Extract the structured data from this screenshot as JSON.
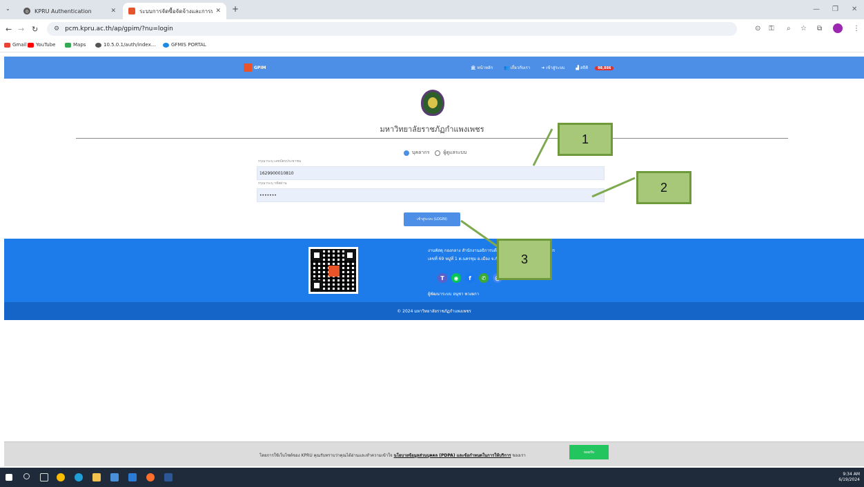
{
  "browser": {
    "tabs": [
      {
        "title": "KPRU Authentication",
        "active": false
      },
      {
        "title": "ระบบการจัดซื้อจัดจ้างและการบริหาร",
        "active": true
      }
    ],
    "url": "pcm.kpru.ac.th/ap/gpim/?nu=login",
    "bookmarks": [
      "Gmail",
      "YouTube",
      "Maps",
      "10.5.0.1/auth/index...",
      "GFMIS PORTAL"
    ]
  },
  "site": {
    "brand": "GPIM",
    "nav": {
      "home": "หน้าหลัก",
      "about": "เกี่ยวกับเรา",
      "login": "เข้าสู่ระบบ",
      "stats": "สถิติ",
      "count": "98,886"
    },
    "university_title": "มหาวิทยาลัยราชภัฏกำแพงเพชร",
    "login_form": {
      "radio_staff": "บุคลากร",
      "radio_admin": "ผู้ดูแลระบบ",
      "id_label": "กรุณาระบุ เลขบัตรประชาชน",
      "id_value": "1629900010810",
      "password_label": "กรุณาระบุ รหัสผ่าน",
      "password_value": "•••••••",
      "submit_label": "เข้าสู่ระบบ (LOGIN)"
    },
    "footer": {
      "address_line1": "งานพัสดุ กองกลาง สำนักงานอธิการบดี มหาวิทยาลัยราชภัฏกำแพงเพชร",
      "address_line2": "เลขที่ 69 หมู่ที่ 1 ต.นครชุม อ.เมือง จ.กำแพงเพชร 62000",
      "developer": "ผู้พัฒนาระบบ อนุชา พวงผกา",
      "copyright": "© 2024 มหาวิทยาลัยราชภัฏกำแพงเพชร"
    }
  },
  "annotations": [
    "1",
    "2",
    "3"
  ],
  "cookie": {
    "text_prefix": "โดยการใช้เว็บไซต์ของ KPRU คุณรับทราบว่าคุณได้อ่านและทำความเข้าใจ",
    "policy_link": "นโยบายข้อมูลส่วนบุคคล (PDPA) และข้อกำหนดในการให้บริการ",
    "text_suffix": "ของเรา",
    "accept": "ยอมรับ"
  },
  "taskbar": {
    "time": "9:34 AM",
    "date": "6/19/2024"
  },
  "colors": {
    "nav": "#4d8ee6",
    "footer": "#1d7bea",
    "callout": "#a6c878"
  }
}
